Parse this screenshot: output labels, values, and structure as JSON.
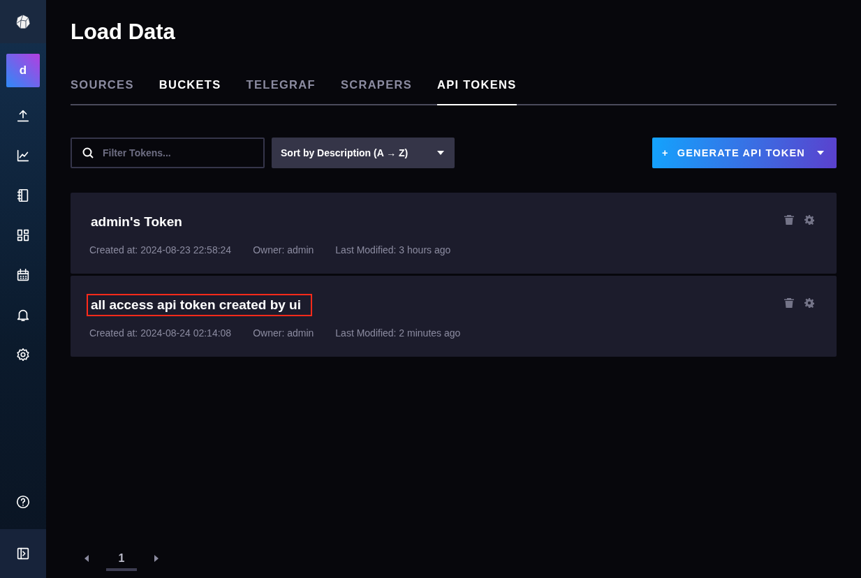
{
  "sidebar": {
    "org_initial": "d"
  },
  "page_title": "Load Data",
  "tabs": [
    {
      "label": "SOURCES",
      "selected": false,
      "hovered": false
    },
    {
      "label": "BUCKETS",
      "selected": false,
      "hovered": true
    },
    {
      "label": "TELEGRAF",
      "selected": false,
      "hovered": false
    },
    {
      "label": "SCRAPERS",
      "selected": false,
      "hovered": false
    },
    {
      "label": "API TOKENS",
      "selected": true,
      "hovered": false
    }
  ],
  "search": {
    "placeholder": "Filter Tokens..."
  },
  "sort_dropdown": {
    "value": "Sort by Description (A → Z)"
  },
  "generate_button": {
    "icon": "+",
    "label": "GENERATE API TOKEN"
  },
  "tokens": [
    {
      "name": "admin's Token",
      "created": "Created at: 2024-08-23 22:58:24",
      "owner": "Owner: admin",
      "modified": "Last Modified: 3 hours ago",
      "highlighted": false
    },
    {
      "name": "all access api token created by ui",
      "created": "Created at: 2024-08-24 02:14:08",
      "owner": "Owner: admin",
      "modified": "Last Modified: 2 minutes ago",
      "highlighted": true
    }
  ],
  "pagination": {
    "pages": [
      {
        "label": "1",
        "selected": true
      }
    ]
  }
}
